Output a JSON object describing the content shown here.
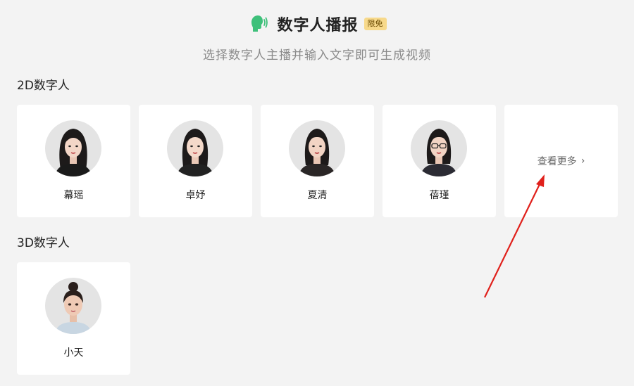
{
  "header": {
    "icon": "speaking-head-icon",
    "title": "数字人播报",
    "badge": "限免",
    "subtitle": "选择数字人主播并输入文字即可生成视频",
    "accent_color": "#3ec07a"
  },
  "sections": [
    {
      "title": "2D数字人",
      "cards": [
        {
          "name": "幕瑶"
        },
        {
          "name": "卓妤"
        },
        {
          "name": "夏清"
        },
        {
          "name": "蓓瑾"
        }
      ],
      "more": {
        "label": "查看更多",
        "icon": "chevron-right-icon"
      }
    },
    {
      "title": "3D数字人",
      "cards": [
        {
          "name": "小天"
        }
      ]
    }
  ],
  "annotation": {
    "icon": "red-arrow-icon",
    "color": "#e0201b"
  }
}
